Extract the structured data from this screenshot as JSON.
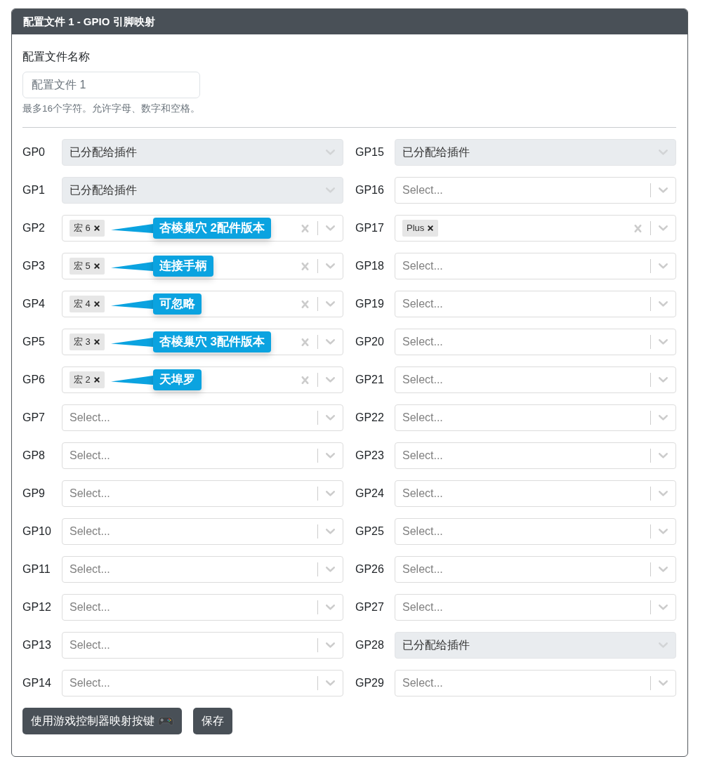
{
  "panel": {
    "title": "配置文件 1 - GPIO 引脚映射"
  },
  "profile_name": {
    "label": "配置文件名称",
    "placeholder": "配置文件 1",
    "help": "最多16个字符。允许字母、数字和空格。"
  },
  "pins": [
    {
      "label": "GP0",
      "kind": "value",
      "disabled": true,
      "value": "已分配给插件"
    },
    {
      "label": "GP1",
      "kind": "value",
      "disabled": true,
      "value": "已分配给插件"
    },
    {
      "label": "GP2",
      "kind": "tags",
      "disabled": false,
      "tags": [
        "宏 6"
      ],
      "annotation": "杏棱巢穴 2配件版本"
    },
    {
      "label": "GP3",
      "kind": "tags",
      "disabled": false,
      "tags": [
        "宏 5"
      ],
      "annotation": "连接手柄"
    },
    {
      "label": "GP4",
      "kind": "tags",
      "disabled": false,
      "tags": [
        "宏 4"
      ],
      "annotation": "可忽略"
    },
    {
      "label": "GP5",
      "kind": "tags",
      "disabled": false,
      "tags": [
        "宏 3"
      ],
      "annotation": "杏棱巢穴 3配件版本"
    },
    {
      "label": "GP6",
      "kind": "tags",
      "disabled": false,
      "tags": [
        "宏 2"
      ],
      "annotation": "天埠罗"
    },
    {
      "label": "GP7",
      "kind": "placeholder",
      "disabled": false,
      "placeholder": "Select..."
    },
    {
      "label": "GP8",
      "kind": "placeholder",
      "disabled": false,
      "placeholder": "Select..."
    },
    {
      "label": "GP9",
      "kind": "placeholder",
      "disabled": false,
      "placeholder": "Select..."
    },
    {
      "label": "GP10",
      "kind": "placeholder",
      "disabled": false,
      "placeholder": "Select..."
    },
    {
      "label": "GP11",
      "kind": "placeholder",
      "disabled": false,
      "placeholder": "Select..."
    },
    {
      "label": "GP12",
      "kind": "placeholder",
      "disabled": false,
      "placeholder": "Select..."
    },
    {
      "label": "GP13",
      "kind": "placeholder",
      "disabled": false,
      "placeholder": "Select..."
    },
    {
      "label": "GP14",
      "kind": "placeholder",
      "disabled": false,
      "placeholder": "Select..."
    },
    {
      "label": "GP15",
      "kind": "value",
      "disabled": true,
      "value": "已分配给插件"
    },
    {
      "label": "GP16",
      "kind": "placeholder",
      "disabled": false,
      "placeholder": "Select..."
    },
    {
      "label": "GP17",
      "kind": "tags",
      "disabled": false,
      "tags": [
        "Plus"
      ]
    },
    {
      "label": "GP18",
      "kind": "placeholder",
      "disabled": false,
      "placeholder": "Select..."
    },
    {
      "label": "GP19",
      "kind": "placeholder",
      "disabled": false,
      "placeholder": "Select..."
    },
    {
      "label": "GP20",
      "kind": "placeholder",
      "disabled": false,
      "placeholder": "Select..."
    },
    {
      "label": "GP21",
      "kind": "placeholder",
      "disabled": false,
      "placeholder": "Select..."
    },
    {
      "label": "GP22",
      "kind": "placeholder",
      "disabled": false,
      "placeholder": "Select..."
    },
    {
      "label": "GP23",
      "kind": "placeholder",
      "disabled": false,
      "placeholder": "Select..."
    },
    {
      "label": "GP24",
      "kind": "placeholder",
      "disabled": false,
      "placeholder": "Select..."
    },
    {
      "label": "GP25",
      "kind": "placeholder",
      "disabled": false,
      "placeholder": "Select..."
    },
    {
      "label": "GP26",
      "kind": "placeholder",
      "disabled": false,
      "placeholder": "Select..."
    },
    {
      "label": "GP27",
      "kind": "placeholder",
      "disabled": false,
      "placeholder": "Select..."
    },
    {
      "label": "GP28",
      "kind": "value",
      "disabled": true,
      "value": "已分配给插件"
    },
    {
      "label": "GP29",
      "kind": "placeholder",
      "disabled": false,
      "placeholder": "Select..."
    }
  ],
  "buttons": [
    {
      "label": "使用游戏控制器映射按键",
      "kind": "icon"
    },
    {
      "label": "保存",
      "kind": "plain"
    }
  ]
}
